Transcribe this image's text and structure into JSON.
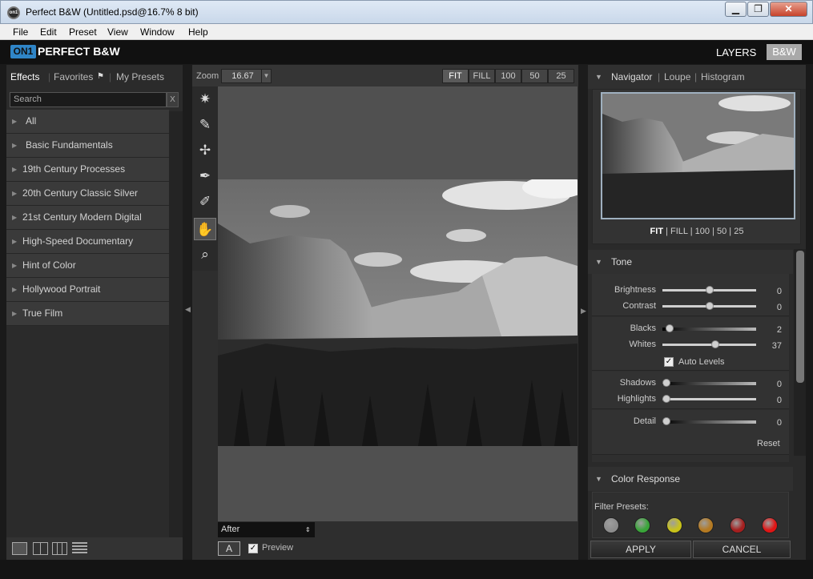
{
  "window": {
    "title": "Perfect B&W (Untitled.psd@16.7% 8 bit)",
    "app_icon_text": "on1",
    "controls": {
      "minimize": "▁",
      "restore": "❐",
      "close": "✕"
    }
  },
  "menu": [
    "File",
    "Edit",
    "Preset",
    "View",
    "Window",
    "Help"
  ],
  "header": {
    "logo_mark": "ON1",
    "product": "PERFECT B&W",
    "layers": "LAYERS",
    "bw": "B&W"
  },
  "left": {
    "tabs": [
      "Effects",
      "Favorites",
      "My Presets"
    ],
    "search_placeholder": "Search",
    "search_clear": "X",
    "categories": [
      "All",
      "Basic Fundamentals",
      "19th Century Processes",
      "20th Century Classic Silver",
      "21st Century Modern Digital",
      "High-Speed Documentary",
      "Hint of Color",
      "Hollywood Portrait",
      "True Film"
    ]
  },
  "center": {
    "zoom_label": "Zoom",
    "zoom_value": "16.67",
    "zoom_buttons": [
      "FIT",
      "FILL",
      "100",
      "50",
      "25"
    ],
    "view_mode": "After",
    "a_button": "A",
    "preview_label": "Preview",
    "preview_checked": true
  },
  "navigator": {
    "tabs": [
      "Navigator",
      "Loupe",
      "Histogram"
    ],
    "zoom_links": [
      "FIT",
      "FILL",
      "100",
      "50",
      "25"
    ]
  },
  "tone": {
    "title": "Tone",
    "brightness": {
      "label": "Brightness",
      "value": "0",
      "pos": 0.5
    },
    "contrast": {
      "label": "Contrast",
      "value": "0",
      "pos": 0.5
    },
    "blacks": {
      "label": "Blacks",
      "value": "2",
      "pos": 0.04
    },
    "whites": {
      "label": "Whites",
      "value": "37",
      "pos": 0.57
    },
    "auto_levels": "Auto Levels",
    "shadows": {
      "label": "Shadows",
      "value": "0",
      "pos": 0.0
    },
    "highlights": {
      "label": "Highlights",
      "value": "0",
      "pos": 0.0
    },
    "detail": {
      "label": "Detail",
      "value": "0",
      "pos": 0.0
    },
    "reset": "Reset"
  },
  "color_response": {
    "title": "Color Response",
    "filter_presets_label": "Filter Presets:",
    "filters": [
      "#8d8d8d",
      "#3aa53a",
      "#c8c21a",
      "#b47a22",
      "#a51f1f",
      "#e01515"
    ]
  },
  "footer": {
    "apply": "APPLY",
    "cancel": "CANCEL"
  }
}
